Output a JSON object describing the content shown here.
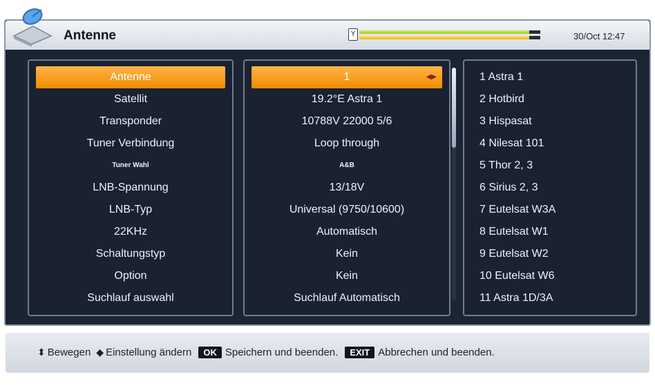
{
  "header": {
    "title": "Antenne",
    "clock": "30/Oct 12:47",
    "signal_icon": "signal-strength-icon",
    "signal_strength": 0.94,
    "signal_quality": 0.94
  },
  "settings": [
    {
      "label": "Antenne",
      "value": "1",
      "selected": true
    },
    {
      "label": "Satellit",
      "value": "19.2°E Astra 1"
    },
    {
      "label": "Transponder",
      "value": "10788V 22000 5/6"
    },
    {
      "label": "Tuner Verbindung",
      "value": "Loop through"
    },
    {
      "label": "Tuner Wahl",
      "value": "A&B",
      "small": true
    },
    {
      "label": "LNB-Spannung",
      "value": "13/18V"
    },
    {
      "label": "LNB-Typ",
      "value": "Universal (9750/10600)"
    },
    {
      "label": "22KHz",
      "value": "Automatisch"
    },
    {
      "label": "Schaltungstyp",
      "value": "Kein"
    },
    {
      "label": "Option",
      "value": "Kein"
    },
    {
      "label": "Suchlauf auswahl",
      "value": "Suchlauf Automatisch"
    }
  ],
  "satellites": [
    "1 Astra 1",
    "2 Hotbird",
    "3 Hispasat",
    "4 Nilesat 101",
    "5 Thor 2, 3",
    "6 Sirius 2, 3",
    "7 Eutelsat W3A",
    "8 Eutelsat W1",
    "9 Eutelsat W2",
    "10 Eutelsat W6",
    "11 Astra 1D/3A"
  ],
  "hints": {
    "move_label": "Bewegen",
    "change_label": "Einstellung ändern",
    "ok_key": "OK",
    "ok_label": "Speichern und beenden.",
    "exit_key": "EXIT",
    "exit_label": "Abbrechen und beenden."
  },
  "colors": {
    "highlight": "#f59a10",
    "background": "#1a2231",
    "text": "#eef2f7"
  }
}
